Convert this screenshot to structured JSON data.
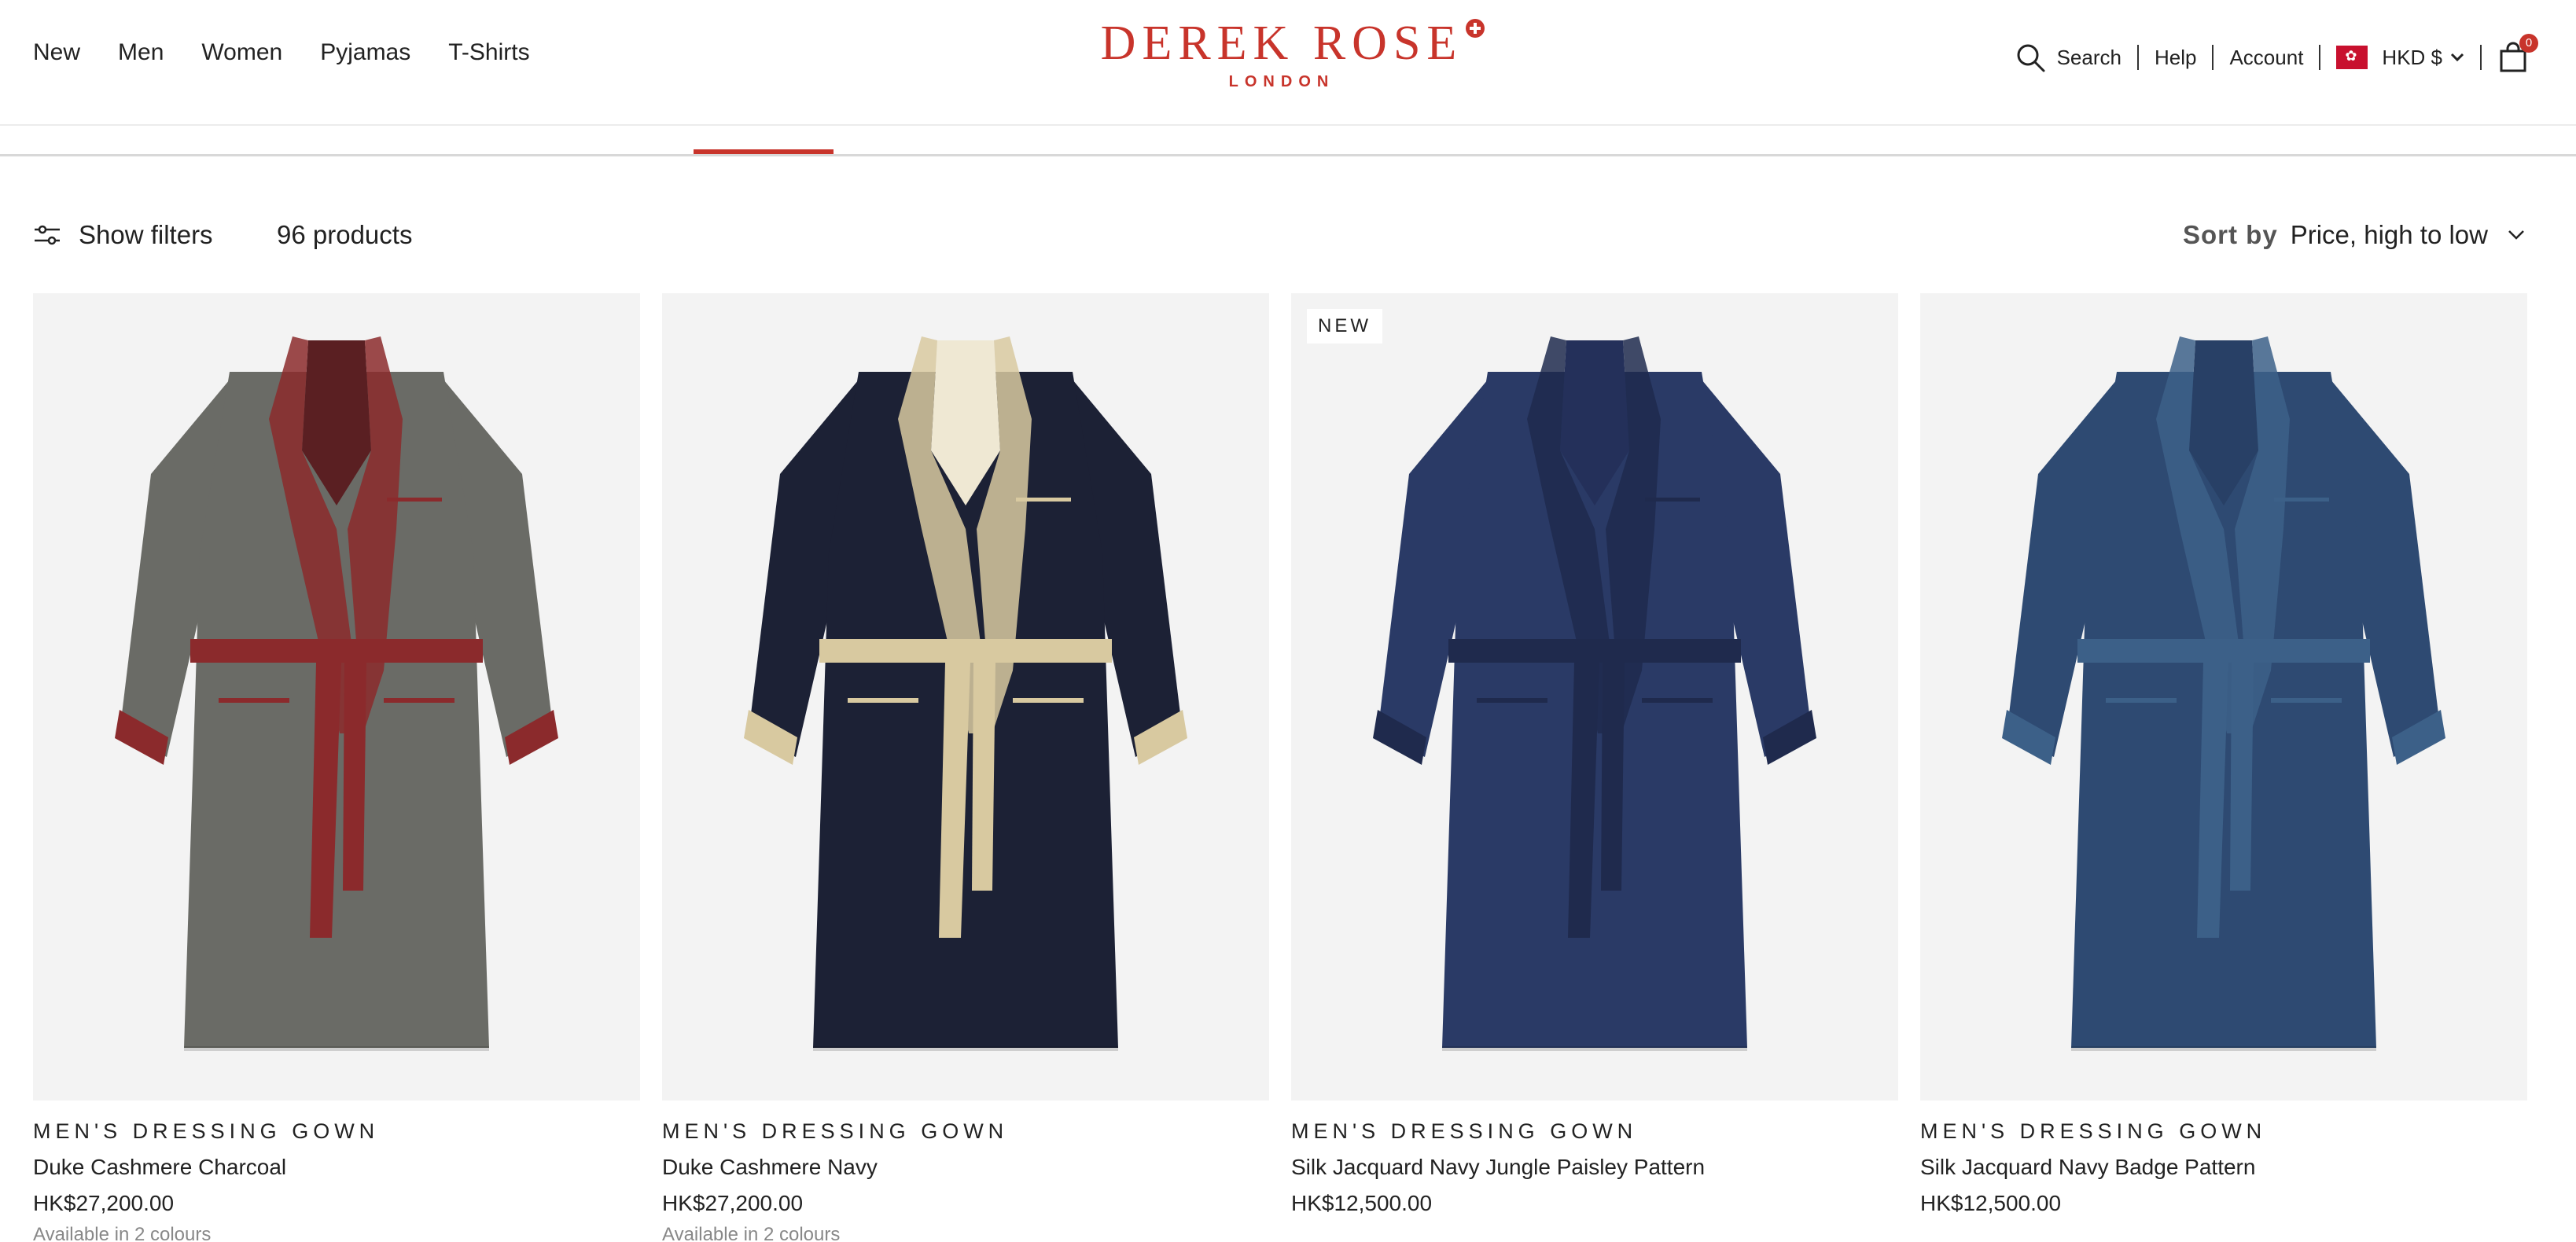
{
  "nav": {
    "items": [
      "New",
      "Men",
      "Women",
      "Pyjamas",
      "T-Shirts"
    ]
  },
  "brand": {
    "name": "DEREK ROSE",
    "city": "LONDON",
    "color": "#c8342b"
  },
  "utility": {
    "search_label": "Search",
    "search_icon": "search-icon",
    "help_label": "Help",
    "account_label": "Account",
    "currency_label": "HKD $",
    "flag_icon": "hong-kong-flag-icon",
    "cart_icon": "shopping-bag-icon",
    "cart_count": "0"
  },
  "toolbar": {
    "filters_label": "Show filters",
    "filters_icon": "sliders-icon",
    "product_count": "96 products",
    "sort_label": "Sort by",
    "sort_value": "Price, high to low"
  },
  "products": [
    {
      "category": "MEN'S DRESSING GOWN",
      "name": "Duke Cashmere Charcoal",
      "price": "HK$27,200.00",
      "availability": "Available in 2 colours",
      "badge": "",
      "colors": {
        "body": "#6a6b66",
        "trim": "#8b2a2c",
        "lining": "#5a1f22"
      }
    },
    {
      "category": "MEN'S DRESSING GOWN",
      "name": "Duke Cashmere Navy",
      "price": "HK$27,200.00",
      "availability": "Available in 2 colours",
      "badge": "",
      "colors": {
        "body": "#1c2135",
        "trim": "#d8c9a0",
        "lining": "#efe8d3"
      }
    },
    {
      "category": "MEN'S DRESSING GOWN",
      "name": "Silk Jacquard Navy Jungle Paisley Pattern",
      "price": "HK$12,500.00",
      "availability": "",
      "badge": "NEW",
      "colors": {
        "body": "#2a3a66",
        "trim": "#1f2a4d",
        "lining": "#24305a"
      }
    },
    {
      "category": "MEN'S DRESSING GOWN",
      "name": "Silk Jacquard Navy Badge Pattern",
      "price": "HK$12,500.00",
      "availability": "",
      "badge": "",
      "colors": {
        "body": "#2e4a72",
        "trim": "#3c6088",
        "lining": "#284066"
      }
    }
  ]
}
